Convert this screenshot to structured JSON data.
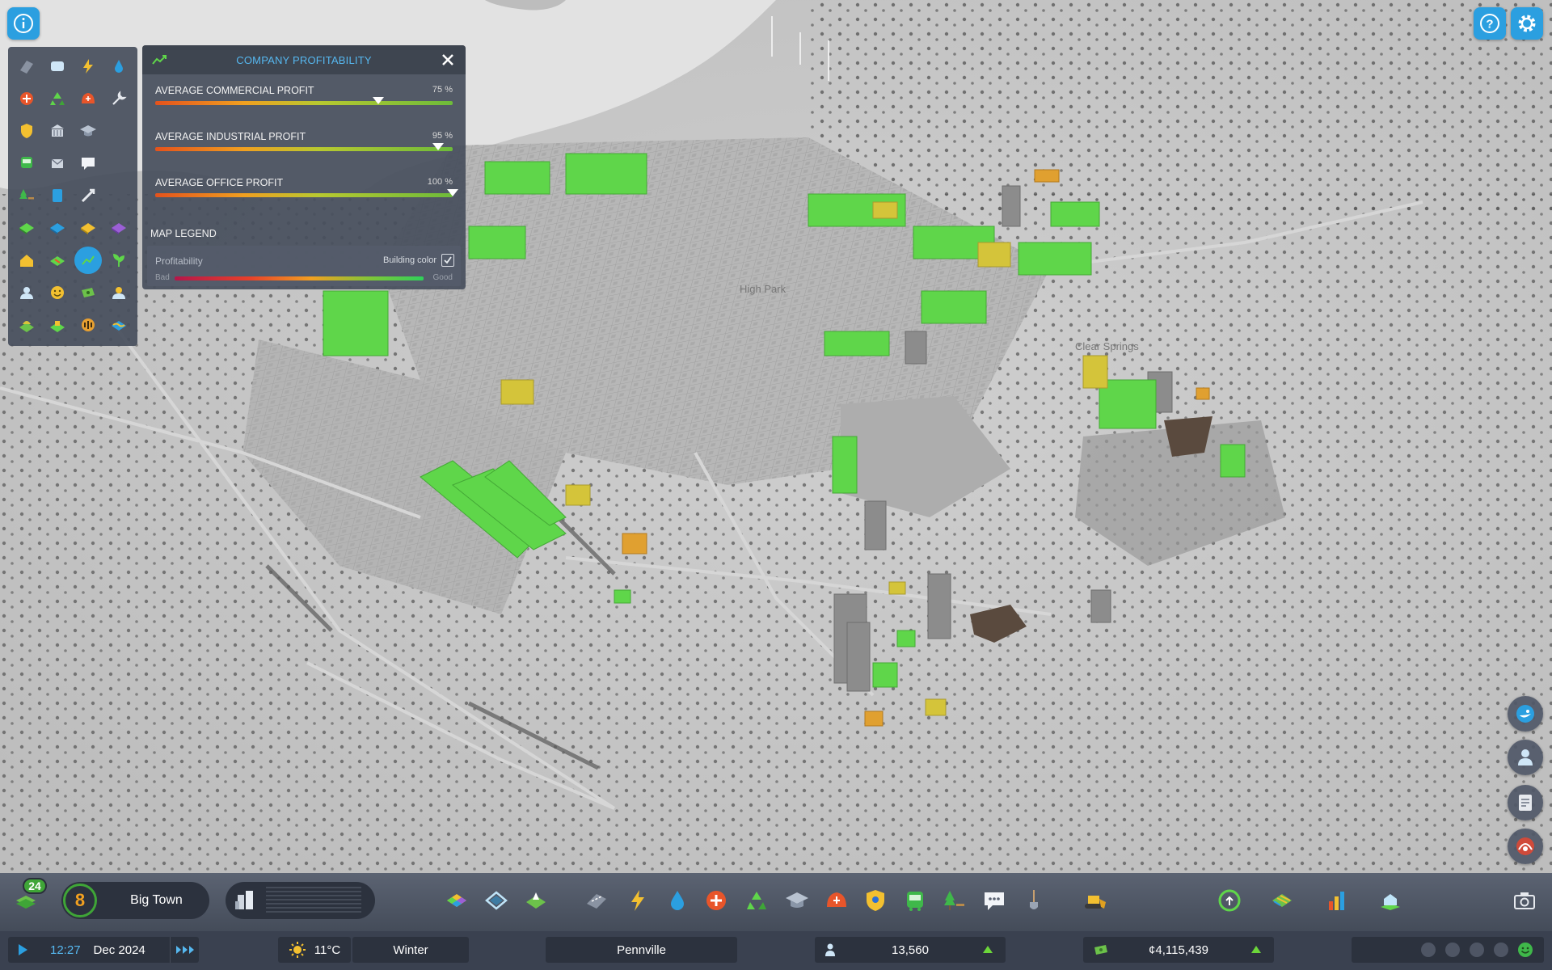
{
  "panel": {
    "title": "COMPANY PROFITABILITY",
    "metrics": [
      {
        "label": "AVERAGE COMMERCIAL PROFIT",
        "value_text": "75 %",
        "value": 75
      },
      {
        "label": "AVERAGE INDUSTRIAL PROFIT",
        "value_text": "95 %",
        "value": 95
      },
      {
        "label": "AVERAGE OFFICE PROFIT",
        "value_text": "100 %",
        "value": 100
      }
    ],
    "legend": {
      "title": "MAP LEGEND",
      "profitability_label": "Profitability",
      "building_color_label": "Building color",
      "building_color_checked": true,
      "bad_label": "Bad",
      "good_label": "Good"
    }
  },
  "map_labels": {
    "district_1": "High Park",
    "district_2": "Clear Springs"
  },
  "infoviews": [
    "roads-icon",
    "transport-icon",
    "electricity-icon",
    "water-icon",
    "fire-icon",
    "recycling-icon",
    "police-icon",
    "maintenance-icon",
    "crime-icon",
    "administration-icon",
    "education-icon",
    "blank",
    "public-transport-icon",
    "mail-icon",
    "communication-icon",
    "blank",
    "parks-icon",
    "cargo-icon",
    "traffic-icon",
    "blank",
    "residential-zone-icon",
    "commercial-zone-icon",
    "industrial-zone-icon",
    "office-zone-icon",
    "residential-demand-icon",
    "resources-icon",
    "profitability-icon",
    "agriculture-icon",
    "citizens-icon",
    "happiness-icon",
    "wealth-icon",
    "workers-icon",
    "pollution-icon",
    "land-value-icon",
    "noise-icon",
    "flood-icon"
  ],
  "infoviews_active_index": 26,
  "toolbar": {
    "milestone_count": "24",
    "level": "8",
    "city_tier": "Big Town"
  },
  "status": {
    "time": "12:27",
    "date": "Dec 2024",
    "temperature": "11°C",
    "season": "Winter",
    "city_name": "Pennville",
    "population": "13,560",
    "money": "¢4,115,439"
  },
  "colors": {
    "accent": "#2b9fe0",
    "good": "#5fd64a",
    "medium": "#d4c43a",
    "poor": "#e0a030",
    "panel": "#464e5c"
  }
}
